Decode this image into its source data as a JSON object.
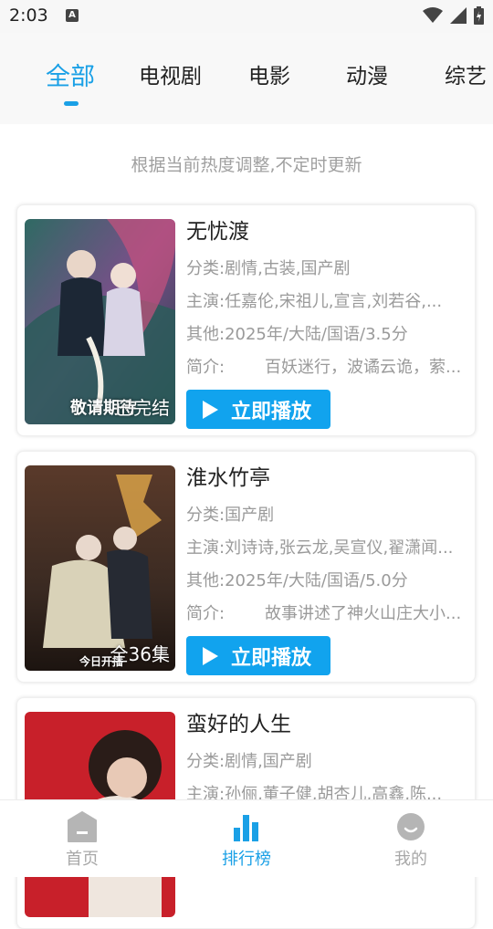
{
  "status_bar": {
    "time": "2:03",
    "a_badge": "A"
  },
  "tabs": [
    {
      "label": "全部",
      "active": true
    },
    {
      "label": "电视剧",
      "active": false
    },
    {
      "label": "电影",
      "active": false
    },
    {
      "label": "动漫",
      "active": false
    },
    {
      "label": "综艺",
      "active": false
    }
  ],
  "notice": "根据当前热度调整,不定时更新",
  "items": [
    {
      "title": "无忧渡",
      "category": "分类:剧情,古装,国产剧",
      "cast": "主演:任嘉伦,宋祖儿,宣言,刘若谷,...",
      "other": "其他:2025年/大陆/国语/3.5分",
      "intro_label": "简介:",
      "intro": "百妖迷行，波谲云诡，萦...",
      "poster_status": "已完结",
      "poster_overlay": "敬请期待",
      "play_label": "立即播放"
    },
    {
      "title": "淮水竹亭",
      "category": "分类:国产剧",
      "cast": "主演:刘诗诗,张云龙,吴宣仪,翟潇闻...",
      "other": "其他:2025年/大陆/国语/5.0分",
      "intro_label": "简介:",
      "intro": "故事讲述了神火山庄大小...",
      "poster_status": "全36集",
      "poster_overlay": "今日开播",
      "play_label": "立即播放"
    },
    {
      "title": "蛮好的人生",
      "category": "分类:剧情,国产剧",
      "cast": "主演:孙俪,董子健,胡杏儿,高鑫,陈..."
    }
  ],
  "bottom_nav": [
    {
      "label": "首页",
      "icon": "home-icon",
      "active": false
    },
    {
      "label": "排行榜",
      "icon": "ranking-icon",
      "active": true
    },
    {
      "label": "我的",
      "icon": "profile-icon",
      "active": false
    }
  ],
  "colors": {
    "accent": "#1aa0e6",
    "button": "#11a3ee",
    "muted": "#9a9a9a"
  }
}
